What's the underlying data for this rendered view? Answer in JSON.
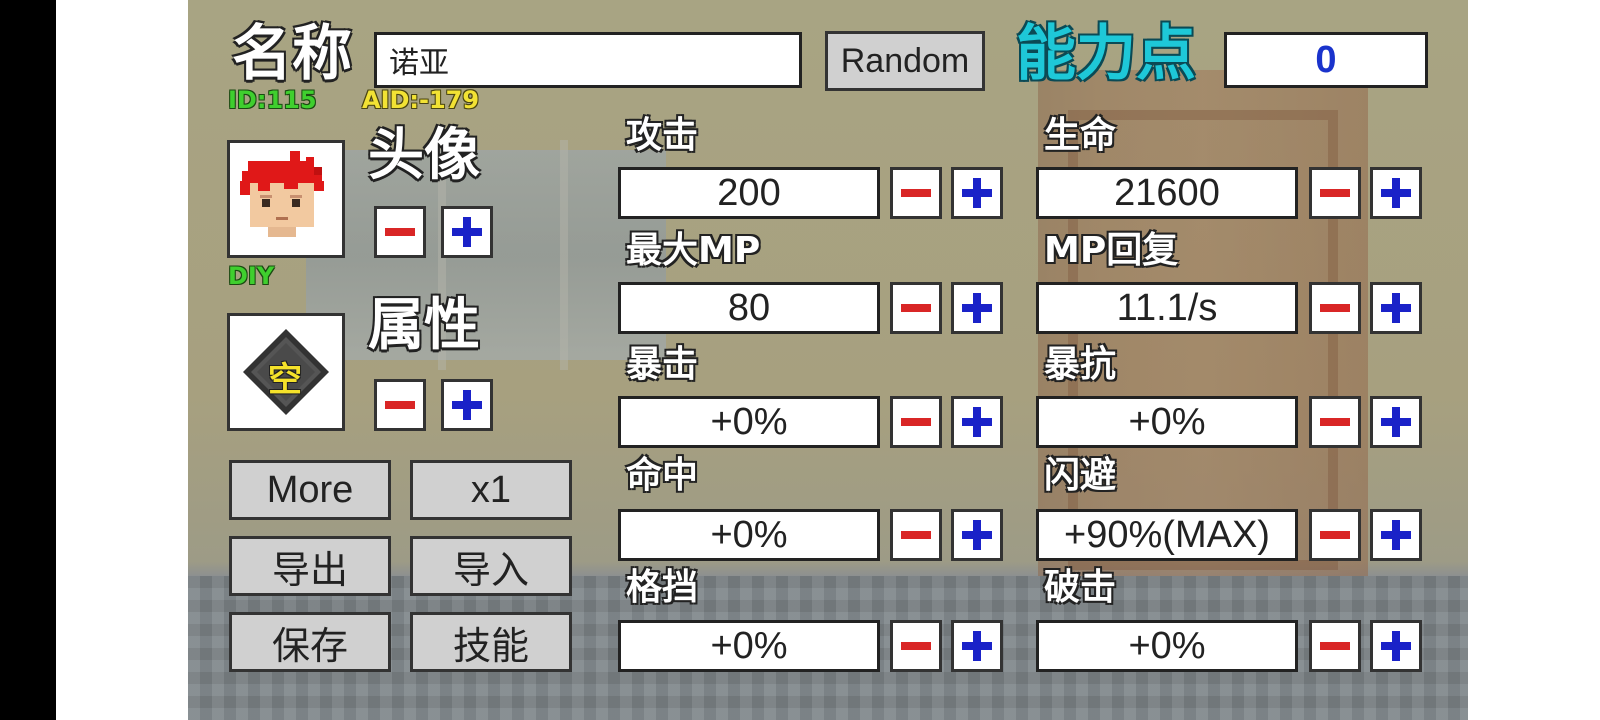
{
  "header": {
    "name_label": "名称",
    "name_value": "诺亚",
    "random_button": "Random",
    "points_label": "能力点",
    "points_value": "0",
    "id_text": "ID:115",
    "aid_text": "AID:-179"
  },
  "avatar": {
    "label": "头像",
    "diy_text": "DIY"
  },
  "attribute": {
    "label": "属性",
    "element_glyph": "空"
  },
  "left_buttons": {
    "more": "More",
    "multiplier": "x1",
    "export": "导出",
    "import": "导入",
    "save": "保存",
    "skills": "技能"
  },
  "stats": {
    "attack": {
      "label": "攻击",
      "value": "200"
    },
    "hp": {
      "label": "生命",
      "value": "21600"
    },
    "max_mp": {
      "label": "最大MP",
      "value": "80"
    },
    "mp_regen": {
      "label": "MP回复",
      "value": "11.1/s"
    },
    "crit": {
      "label": "暴击",
      "value": "+0%"
    },
    "crit_resist": {
      "label": "暴抗",
      "value": "+0%"
    },
    "hit": {
      "label": "命中",
      "value": "+0%"
    },
    "dodge": {
      "label": "闪避",
      "value": "+90%(MAX)"
    },
    "block": {
      "label": "格挡",
      "value": "+0%"
    },
    "armor_break": {
      "label": "破击",
      "value": "+0%"
    }
  },
  "icons": {
    "minus": "minus-icon",
    "plus": "plus-icon"
  },
  "colors": {
    "minus": "#d92626",
    "plus": "#1a22c8",
    "points": "#1a33cc",
    "points_label": "#1ec8d8",
    "id_green": "#3fcf2e",
    "aid_yellow": "#f2e234"
  }
}
